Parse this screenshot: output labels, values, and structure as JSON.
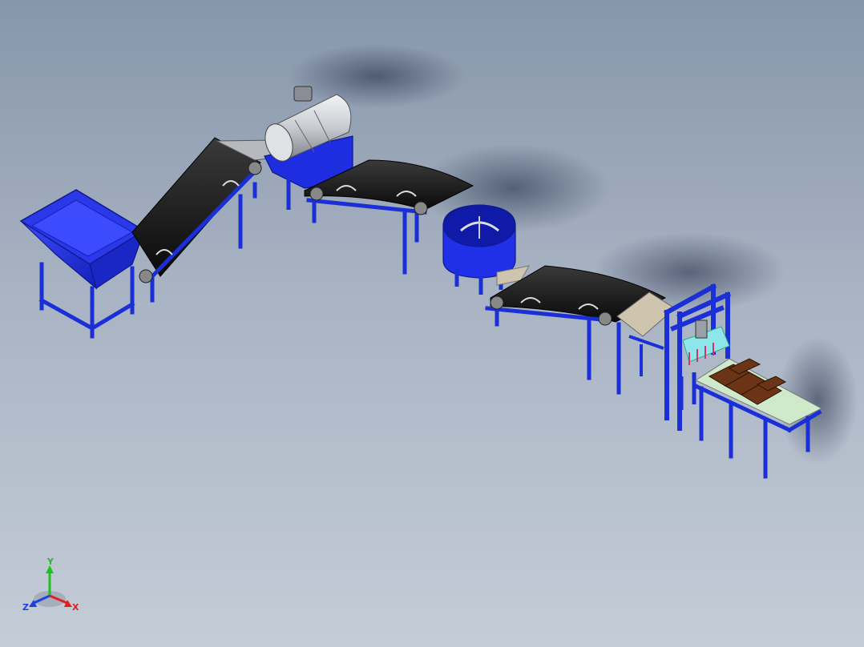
{
  "view": {
    "background_top": "#8796ab",
    "background_bottom": "#c4ccd7"
  },
  "colors": {
    "frame_blue": "#1a2fd6",
    "frame_blue_dark": "#0d1a8a",
    "hopper_blue": "#2233e0",
    "belt_black": "#141414",
    "drum_silver": "#c9ccd2",
    "tray_tan": "#cfc5ae",
    "brick_brown": "#6b3417",
    "pallet_green": "#cfeacb",
    "mold_cyan": "#8fe6ea"
  },
  "triad": {
    "x_label": "X",
    "y_label": "Y",
    "z_label": "Z",
    "x_color": "#e02020",
    "y_color": "#20c020",
    "z_color": "#2040e0"
  }
}
